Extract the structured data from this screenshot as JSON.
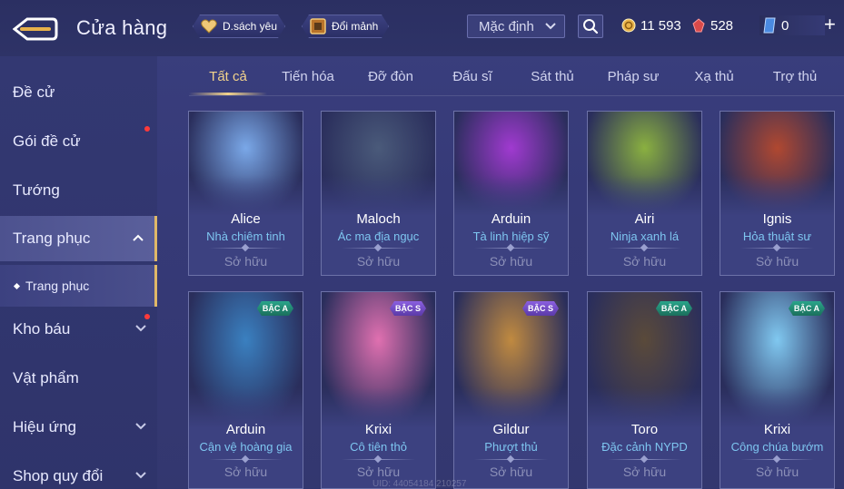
{
  "header": {
    "title": "Cửa hàng",
    "wishlist_label": "D.sách yêu",
    "exchange_label": "Đổi mảnh",
    "sort_value": "Mặc định",
    "currencies": {
      "gold": "11 593",
      "ruby": "528",
      "voucher": "0"
    }
  },
  "sidebar": {
    "items": [
      {
        "label": "Đề cử"
      },
      {
        "label": "Gói đề cử"
      },
      {
        "label": "Tướng"
      },
      {
        "label": "Trang phục"
      },
      {
        "label": "Trang phục"
      },
      {
        "label": "Kho báu"
      },
      {
        "label": "Vật phẩm"
      },
      {
        "label": "Hiệu ứng"
      },
      {
        "label": "Shop quy đổi"
      }
    ]
  },
  "tabs": [
    "Tất cả",
    "Tiến hóa",
    "Đỡ đòn",
    "Đấu sĩ",
    "Sát thủ",
    "Pháp sư",
    "Xạ thủ",
    "Trợ thủ"
  ],
  "cards": [
    {
      "hero": "Alice",
      "skin": "Nhà chiêm tinh",
      "status": "Sở hữu",
      "badge": "",
      "accent": "#7aa8e8"
    },
    {
      "hero": "Maloch",
      "skin": "Ác ma địa ngục",
      "status": "Sở hữu",
      "badge": "",
      "accent": "#4a5a7a"
    },
    {
      "hero": "Arduin",
      "skin": "Tà linh hiệp sỹ",
      "status": "Sở hữu",
      "badge": "",
      "accent": "#a03ad0"
    },
    {
      "hero": "Airi",
      "skin": "Ninja xanh lá",
      "status": "Sở hữu",
      "badge": "",
      "accent": "#8ab040"
    },
    {
      "hero": "Ignis",
      "skin": "Hỏa thuật sư",
      "status": "Sở hữu",
      "badge": "",
      "accent": "#b04830"
    },
    {
      "hero": "Arduin",
      "skin": "Cận vệ hoàng gia",
      "status": "Sở hữu",
      "badge": "BẬC A",
      "accent": "#3a80c0"
    },
    {
      "hero": "Krixi",
      "skin": "Cô tiên thỏ",
      "status": "Sở hữu",
      "badge": "BẬC S",
      "accent": "#e070b0"
    },
    {
      "hero": "Gildur",
      "skin": "Phượt thủ",
      "status": "Sở hữu",
      "badge": "BẬC S",
      "accent": "#c08a40"
    },
    {
      "hero": "Toro",
      "skin": "Đặc cảnh NYPD",
      "status": "Sở hữu",
      "badge": "BẬC A",
      "accent": "#5a4a3a"
    },
    {
      "hero": "Krixi",
      "skin": "Công chúa bướm",
      "status": "Sở hữu",
      "badge": "BẬC A",
      "accent": "#80c8f0"
    }
  ],
  "uid_text": "UID: 44054184 210257"
}
